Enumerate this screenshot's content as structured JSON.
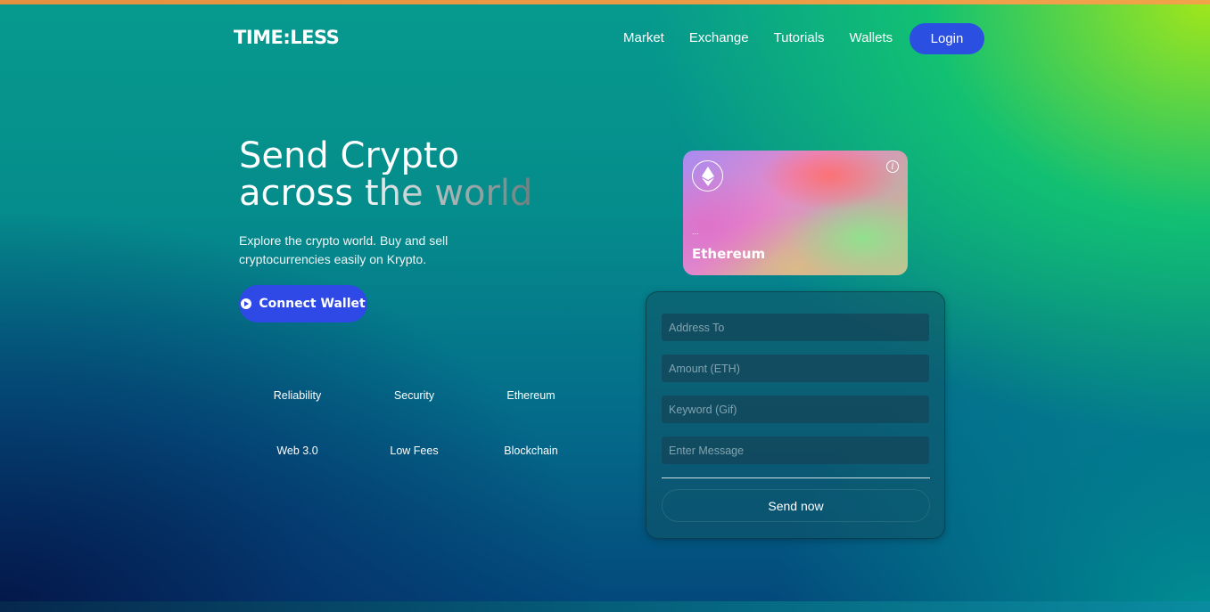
{
  "brand": {
    "logo": "TIME:LESS"
  },
  "nav": {
    "items": [
      {
        "label": "Market"
      },
      {
        "label": "Exchange"
      },
      {
        "label": "Tutorials"
      },
      {
        "label": "Wallets"
      }
    ],
    "login_label": "Login"
  },
  "hero": {
    "title_line1": "Send Crypto",
    "title_line2": "across the world",
    "subtitle": "Explore the crypto world. Buy and sell cryptocurrencies easily on Krypto.",
    "connect_label": "Connect Wallet",
    "features": [
      "Reliability",
      "Security",
      "Ethereum",
      "Web 3.0",
      "Low Fees",
      "Blockchain"
    ]
  },
  "card": {
    "address": "...",
    "name": "Ethereum",
    "icons": {
      "coin": "ethereum-icon",
      "info": "info-icon"
    }
  },
  "form": {
    "address_placeholder": "Address To",
    "amount_placeholder": "Amount (ETH)",
    "keyword_placeholder": "Keyword (Gif)",
    "message_placeholder": "Enter Message",
    "send_label": "Send now"
  },
  "colors": {
    "accent_blue": "#2b4fe0",
    "top_bar": "#e5903f"
  }
}
